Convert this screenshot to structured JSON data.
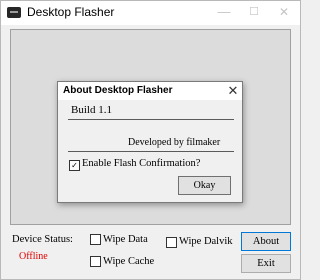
{
  "window": {
    "title": "Desktop Flasher",
    "controls": {
      "minimize": "—",
      "maximize": "☐",
      "close": "✕"
    }
  },
  "dialog": {
    "title": "About Desktop Flasher",
    "close": "✕",
    "build": "Build 1.1",
    "developer": "Developed by filmaker",
    "confirmation": {
      "label": "Enable Flash Confirmation?",
      "checked": true,
      "mark": "✓"
    },
    "ok_label": "Okay"
  },
  "status": {
    "label": "Device Status:",
    "value": "Offline",
    "value_color": "#e00000"
  },
  "options": {
    "wipe_data": {
      "label": "Wipe Data",
      "checked": false
    },
    "wipe_cache": {
      "label": "Wipe Cache",
      "checked": false
    },
    "wipe_dalvik": {
      "label": "Wipe Dalvik",
      "checked": false
    }
  },
  "buttons": {
    "about": "About",
    "exit": "Exit"
  },
  "colors": {
    "accent_focus": "#0078d7",
    "panel_bg": "#dcdcdc"
  }
}
